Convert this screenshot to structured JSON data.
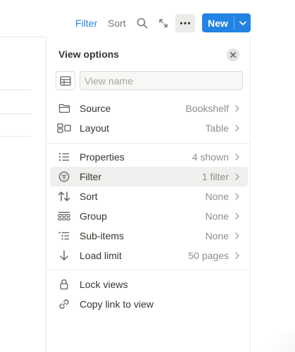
{
  "toolbar": {
    "filter_label": "Filter",
    "sort_label": "Sort",
    "new_label": "New",
    "icons": {
      "search": "search-icon",
      "expand": "expand-icon",
      "more": "more-icon",
      "caret": "chevron-down-icon"
    }
  },
  "panel": {
    "title": "View options",
    "view_name_placeholder": "View name",
    "view_name_value": "",
    "groups": [
      [
        {
          "id": "source",
          "label": "Source",
          "value": "Bookshelf",
          "icon": "folder-icon"
        },
        {
          "id": "layout",
          "label": "Layout",
          "value": "Table",
          "icon": "layout-icon"
        }
      ],
      [
        {
          "id": "properties",
          "label": "Properties",
          "value": "4 shown",
          "icon": "list-icon"
        },
        {
          "id": "filter",
          "label": "Filter",
          "value": "1 filter",
          "icon": "filter-icon",
          "active": true
        },
        {
          "id": "sort",
          "label": "Sort",
          "value": "None",
          "icon": "sort-icon"
        },
        {
          "id": "group",
          "label": "Group",
          "value": "None",
          "icon": "group-icon"
        },
        {
          "id": "sub-items",
          "label": "Sub-items",
          "value": "None",
          "icon": "sub-items-icon"
        },
        {
          "id": "load-limit",
          "label": "Load limit",
          "value": "50 pages",
          "icon": "arrow-down-icon"
        }
      ],
      [
        {
          "id": "lock",
          "label": "Lock views",
          "value": "",
          "icon": "lock-icon"
        },
        {
          "id": "copy-link",
          "label": "Copy link to view",
          "value": "",
          "icon": "link-icon"
        }
      ]
    ]
  },
  "colors": {
    "accent": "#2383e2",
    "text": "#37352f",
    "muted": "#8f8e8a",
    "active_row": "#efefed"
  }
}
